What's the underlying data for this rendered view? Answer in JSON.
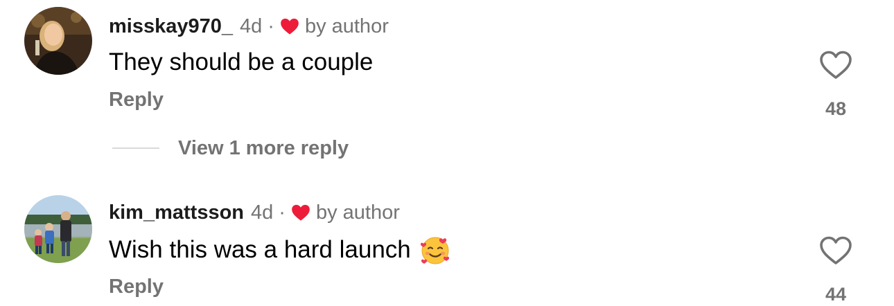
{
  "comments": [
    {
      "username": "misskay970_",
      "time": "4d",
      "separator": "·",
      "badge": "by author",
      "text": "They should be a couple",
      "emoji": "",
      "reply_label": "Reply",
      "like_count": "48",
      "liked_by_author_color": "#ed1c3a"
    },
    {
      "username": "kim_mattsson",
      "time": "4d",
      "separator": "·",
      "badge": "by author",
      "text": "Wish this was a hard launch",
      "emoji": "smiling-face-with-hearts",
      "reply_label": "Reply",
      "like_count": "44",
      "liked_by_author_color": "#ed1c3a"
    }
  ],
  "view_more_label": "View 1 more reply",
  "colors": {
    "secondary_text": "#737373",
    "heart_red": "#ed1c3a",
    "divider": "#d9d9d9"
  }
}
